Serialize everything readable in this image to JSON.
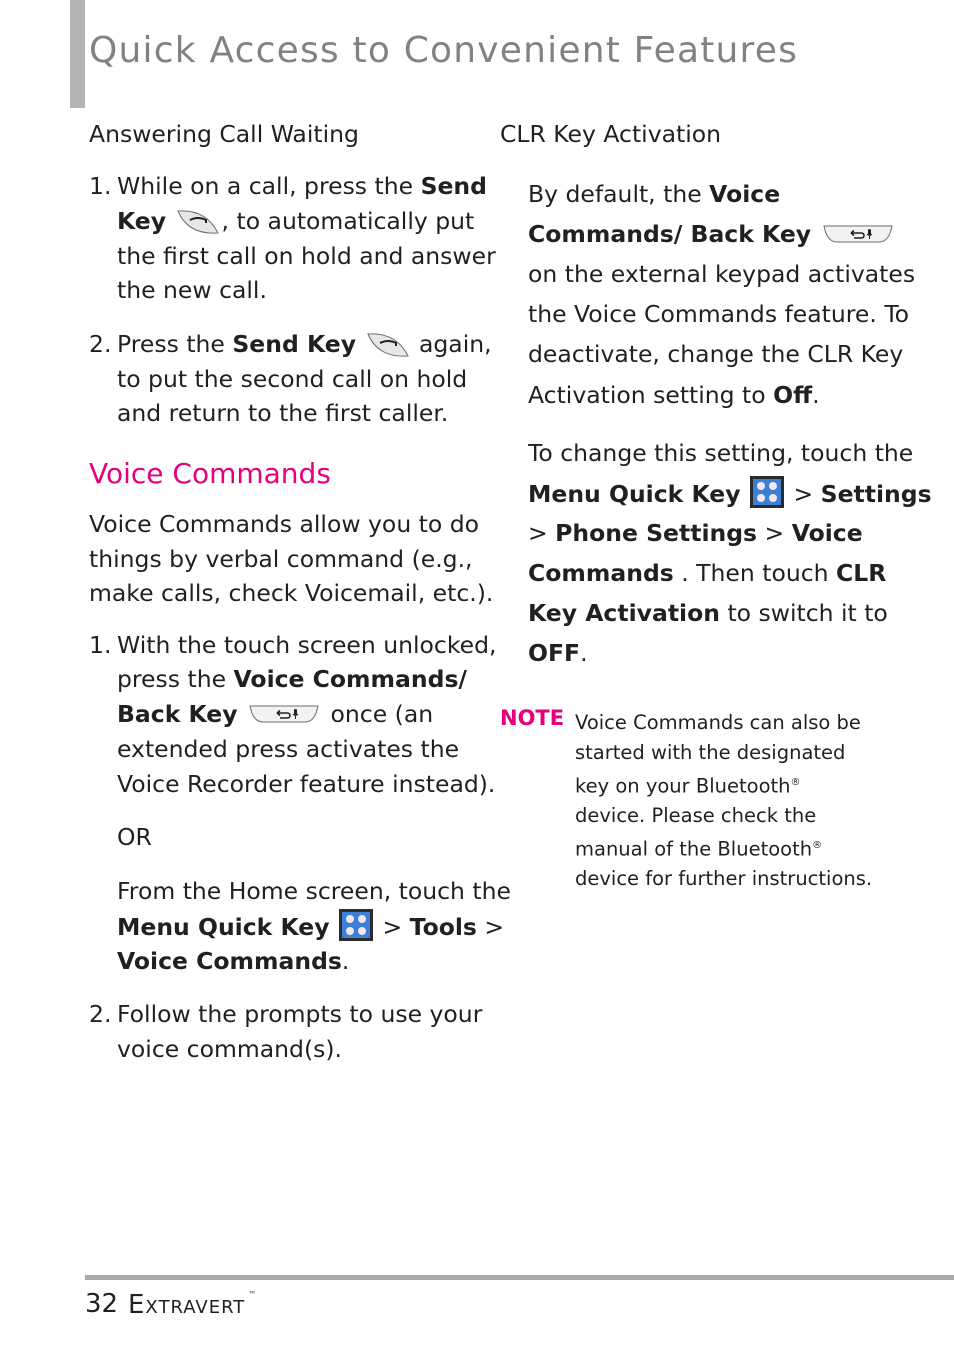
{
  "page": {
    "title": "Quick Access to Convenient Features",
    "page_number": "32",
    "brand": "Extravert",
    "brand_mark": "™",
    "accent_color": "#e6007e"
  },
  "left": {
    "subheading": "Answering Call Waiting",
    "step1": {
      "num": "1.",
      "l1a": "While on a call, press the ",
      "l1b": "Send",
      "l2a": "Key",
      "l2b": ", to automatically put",
      "l3": "the first call on hold and answer",
      "l4": "the new call."
    },
    "step2": {
      "num": "2.",
      "l1a": "Press the ",
      "l1b": "Send Key",
      "l1c": " again,",
      "l2": "to put the second call on hold",
      "l3": "and return to the first caller."
    },
    "section_heading": "Voice Commands",
    "intro": [
      "Voice Commands allow you to do",
      "things by verbal command (e.g.,",
      "make calls, check Voicemail, etc.)."
    ],
    "vc_step1": {
      "num": "1.",
      "l1": "With the touch screen unlocked,",
      "l2a": "press the ",
      "l2b": "Voice Commands/",
      "l3a": "Back Key",
      "l3b": " once (an",
      "l4": "extended press activates the",
      "l5": "Voice Recorder feature instead).",
      "or": "OR",
      "l6": "From the Home screen, touch the",
      "l7a": "Menu Quick Key",
      "l7b": " > ",
      "l7c": "Tools",
      "l7d": " >",
      "l8a": "Voice Commands",
      "l8b": "."
    },
    "vc_step2": {
      "num": "2.",
      "l1": "Follow the prompts to use your",
      "l2": "voice command(s)."
    }
  },
  "right": {
    "subheading": "CLR Key Activation",
    "p1": {
      "l1a": "By default, the ",
      "l1b": "Voice",
      "l2a": "Commands/ Back Key",
      "l3": "on the external keypad activates",
      "l4": "the Voice Commands feature. To",
      "l5": "deactivate, change the CLR Key",
      "l6a": "Activation setting to ",
      "l6b": "Off",
      "l6c": "."
    },
    "p2": {
      "l1": "To change this setting, touch the",
      "l2a": "Menu Quick Key",
      "l2b": " > ",
      "l2c": "Settings",
      "l3a": "> ",
      "l3b": "Phone Settings",
      "l3c": " > ",
      "l3d": "Voice",
      "l4a": "Commands",
      "l4b": " . Then touch ",
      "l4c": "CLR",
      "l5a": "Key Activation",
      "l5b": " to switch it to",
      "l6a": "OFF",
      "l6b": "."
    },
    "note": {
      "label": "NOTE",
      "t1": "Voice Commands can also be started with the designated key on your Bluetooth",
      "reg": "®",
      "t2": " device. Please check the manual of the Bluetooth",
      "t3": " device for further instructions."
    }
  },
  "icons": {
    "send_key": "send-key-icon",
    "back_key": "voice-commands-back-key-icon",
    "menu_quick_key": "menu-quick-key-icon"
  }
}
